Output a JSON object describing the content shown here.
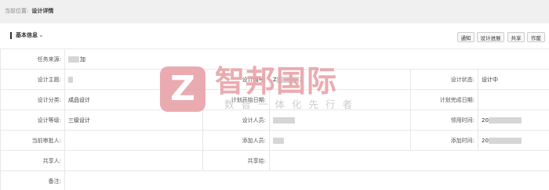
{
  "breadcrumb": {
    "prefix": "当前位置:",
    "current": "设计详情"
  },
  "section": {
    "title": "基本信息",
    "chevron": "⌄"
  },
  "actions": {
    "notify": "通知",
    "progress": "设计进展",
    "share": "共享",
    "void": "作废"
  },
  "fields": {
    "task_source": {
      "label": "任务来源:",
      "value": "加"
    },
    "design_subject": {
      "label": "设计主题:",
      "value": ""
    },
    "design_code": {
      "label": "设计编号:",
      "value": "Z",
      "value_tail": "1"
    },
    "design_status": {
      "label": "设计状态:",
      "value": "设计中"
    },
    "design_category": {
      "label": "设计分类:",
      "value": "成品设计"
    },
    "plan_start_date": {
      "label": "计划开始日期:",
      "value": ""
    },
    "plan_end_date": {
      "label": "计划完成日期:",
      "value": ""
    },
    "design_level": {
      "label": "设计等级:",
      "value": "三级设计"
    },
    "designer": {
      "label": "设计人员:",
      "value": ""
    },
    "receive_time": {
      "label": "领用时间:",
      "value": "20"
    },
    "current_reviewer": {
      "label": "当前审批人:",
      "value": ""
    },
    "added_by": {
      "label": "添加人员:",
      "value": ""
    },
    "added_time": {
      "label": "添加时间:",
      "value": "20"
    },
    "sharer": {
      "label": "共享人:",
      "value": ""
    },
    "shared_to": {
      "label": "共享给:",
      "value": ""
    },
    "remark": {
      "label": "备注:",
      "value": ""
    }
  },
  "watermark": {
    "logo_letter": "Z",
    "name": "智邦国际",
    "slogan": "数智一体化先行者",
    "color": "#e8a3a8"
  }
}
